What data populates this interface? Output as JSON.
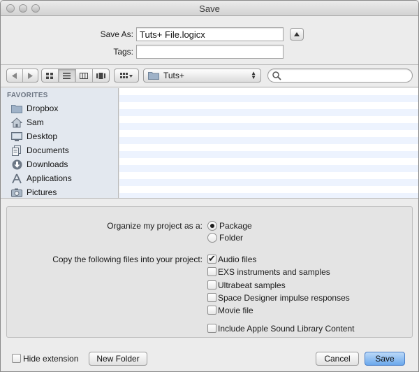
{
  "window": {
    "title": "Save"
  },
  "save_as": {
    "label": "Save As:",
    "value": "Tuts+ File.logicx"
  },
  "tags": {
    "label": "Tags:",
    "value": ""
  },
  "toolbar": {
    "location": "Tuts+",
    "search_placeholder": "",
    "view_modes": [
      "icon-view-icon",
      "list-view-icon",
      "column-view-icon",
      "coverflow-view-icon"
    ]
  },
  "sidebar": {
    "header": "FAVORITES",
    "items": [
      {
        "label": "Dropbox",
        "icon": "folder-icon"
      },
      {
        "label": "Sam",
        "icon": "home-icon"
      },
      {
        "label": "Desktop",
        "icon": "desktop-icon"
      },
      {
        "label": "Documents",
        "icon": "documents-icon"
      },
      {
        "label": "Downloads",
        "icon": "downloads-icon"
      },
      {
        "label": "Applications",
        "icon": "applications-icon"
      },
      {
        "label": "Pictures",
        "icon": "pictures-icon"
      }
    ]
  },
  "options": {
    "organize_label": "Organize my project as a:",
    "organize_choices": [
      {
        "label": "Package",
        "selected": true
      },
      {
        "label": "Folder",
        "selected": false
      }
    ],
    "copy_label": "Copy the following files into your project:",
    "copy_choices": [
      {
        "label": "Audio files",
        "checked": true
      },
      {
        "label": "EXS instruments and samples",
        "checked": false
      },
      {
        "label": "Ultrabeat samples",
        "checked": false
      },
      {
        "label": "Space Designer impulse responses",
        "checked": false
      },
      {
        "label": "Movie file",
        "checked": false
      }
    ],
    "apple_sound": {
      "label": "Include Apple Sound Library Content",
      "checked": false
    }
  },
  "footer": {
    "hide_extension": {
      "label": "Hide extension",
      "checked": false
    },
    "new_folder": "New Folder",
    "cancel": "Cancel",
    "save": "Save"
  },
  "colors": {
    "accent": "#6ba8ec",
    "sidebar_bg": "#e3e8ef",
    "row_alt": "#edf3fe"
  }
}
